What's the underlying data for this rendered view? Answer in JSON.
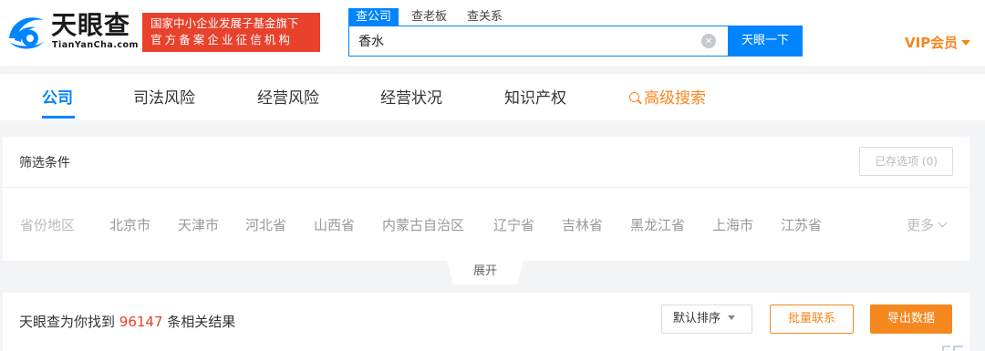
{
  "logo": {
    "cn": "天眼查",
    "en": "TianYanCha.com"
  },
  "badge": {
    "line1": "国家中小企业发展子基金旗下",
    "line2": "官方备案企业征信机构"
  },
  "search": {
    "tabs": [
      "查公司",
      "查老板",
      "查关系"
    ],
    "value": "香水",
    "button": "天眼一下",
    "clear_icon": "×"
  },
  "vip": "VIP会员",
  "nav": {
    "items": [
      "公司",
      "司法风险",
      "经营风险",
      "经营状况",
      "知识产权"
    ],
    "advanced": "高级搜索"
  },
  "filter": {
    "title": "筛选条件",
    "saved": "已存选项 (0)",
    "region_label": "省份地区",
    "regions": [
      "北京市",
      "天津市",
      "河北省",
      "山西省",
      "内蒙古自治区",
      "辽宁省",
      "吉林省",
      "黑龙江省",
      "上海市",
      "江苏省"
    ],
    "more": "更多",
    "expand": "展开"
  },
  "result": {
    "prefix": "天眼查为你找到",
    "count": "96147",
    "suffix": "条相关结果",
    "sort": "默认排序",
    "contact": "批量联系",
    "export": "导出数据"
  },
  "colors": {
    "primary": "#0084ff",
    "accent": "#f5871f",
    "badge": "#e8412c"
  }
}
